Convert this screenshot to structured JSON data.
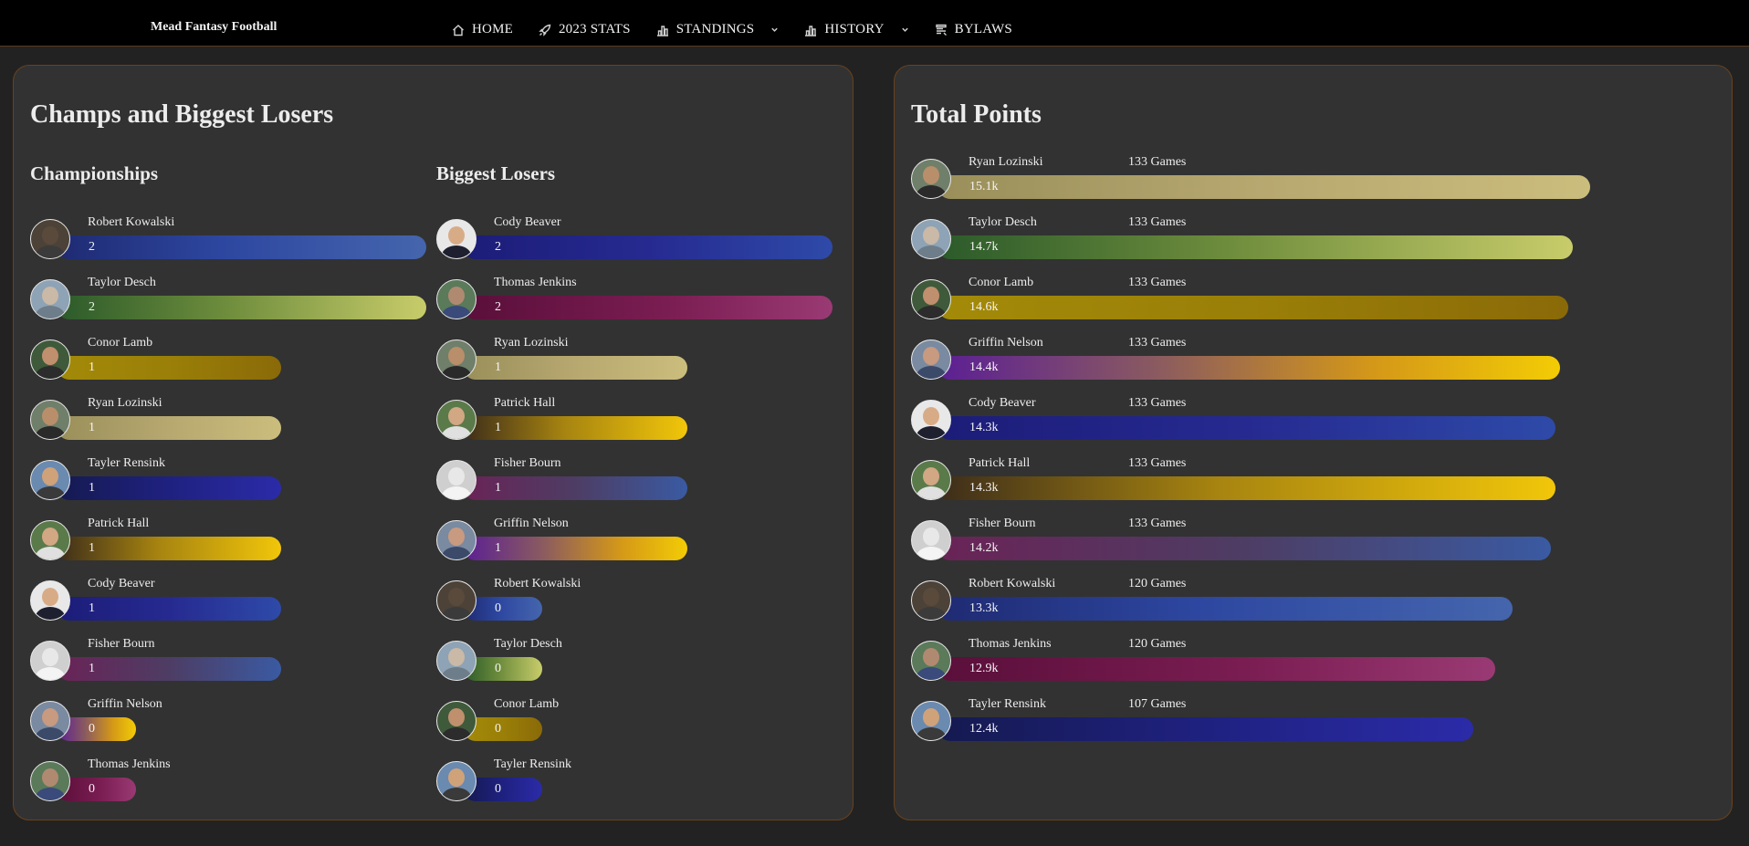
{
  "nav": {
    "brand": "Mead Fantasy Football",
    "items": [
      {
        "label": "HOME",
        "icon": "home-icon"
      },
      {
        "label": "2023 STATS",
        "icon": "rocket-icon"
      },
      {
        "label": "STANDINGS",
        "icon": "bar-chart-icon",
        "dropdown": true
      },
      {
        "label": "HISTORY",
        "icon": "bar-chart-icon",
        "dropdown": true
      },
      {
        "label": "BYLAWS",
        "icon": "document-icon"
      }
    ]
  },
  "champs_card": {
    "title": "Champs and Biggest Losers",
    "championships": {
      "title": "Championships",
      "rows": [
        {
          "name": "Robert Kowalski",
          "value": "2",
          "gradient": "blue",
          "bar_fraction": 1.0
        },
        {
          "name": "Taylor Desch",
          "value": "2",
          "gradient": "green",
          "bar_fraction": 1.0
        },
        {
          "name": "Conor Lamb",
          "value": "1",
          "gradient": "gold",
          "bar_fraction": 0.5
        },
        {
          "name": "Ryan Lozinski",
          "value": "1",
          "gradient": "tan",
          "bar_fraction": 0.5
        },
        {
          "name": "Tayler Rensink",
          "value": "1",
          "gradient": "navy",
          "bar_fraction": 0.5
        },
        {
          "name": "Patrick Hall",
          "value": "1",
          "gradient": "brgold",
          "bar_fraction": 0.5
        },
        {
          "name": "Cody Beaver",
          "value": "1",
          "gradient": "indigo",
          "bar_fraction": 0.5
        },
        {
          "name": "Fisher Bourn",
          "value": "1",
          "gradient": "mauve",
          "bar_fraction": 0.5
        },
        {
          "name": "Griffin Nelson",
          "value": "0",
          "gradient": "purple",
          "bar_fraction": 0
        },
        {
          "name": "Thomas Jenkins",
          "value": "0",
          "gradient": "maroon",
          "bar_fraction": 0
        }
      ]
    },
    "losers": {
      "title": "Biggest Losers",
      "rows": [
        {
          "name": "Cody Beaver",
          "value": "2",
          "gradient": "indigo",
          "bar_fraction": 1.0
        },
        {
          "name": "Thomas Jenkins",
          "value": "2",
          "gradient": "maroon",
          "bar_fraction": 1.0
        },
        {
          "name": "Ryan Lozinski",
          "value": "1",
          "gradient": "tan",
          "bar_fraction": 0.5
        },
        {
          "name": "Patrick Hall",
          "value": "1",
          "gradient": "brgold",
          "bar_fraction": 0.5
        },
        {
          "name": "Fisher Bourn",
          "value": "1",
          "gradient": "mauve",
          "bar_fraction": 0.5
        },
        {
          "name": "Griffin Nelson",
          "value": "1",
          "gradient": "purple",
          "bar_fraction": 0.5
        },
        {
          "name": "Robert Kowalski",
          "value": "0",
          "gradient": "blue",
          "bar_fraction": 0
        },
        {
          "name": "Taylor Desch",
          "value": "0",
          "gradient": "green",
          "bar_fraction": 0
        },
        {
          "name": "Conor Lamb",
          "value": "0",
          "gradient": "gold",
          "bar_fraction": 0
        },
        {
          "name": "Tayler Rensink",
          "value": "0",
          "gradient": "navy",
          "bar_fraction": 0
        }
      ]
    }
  },
  "points_card": {
    "title": "Total Points",
    "rows": [
      {
        "name": "Ryan Lozinski",
        "games": "133 Games",
        "value": "15.1k",
        "gradient": "tan",
        "points": 15.1
      },
      {
        "name": "Taylor Desch",
        "games": "133 Games",
        "value": "14.7k",
        "gradient": "green",
        "points": 14.7
      },
      {
        "name": "Conor Lamb",
        "games": "133 Games",
        "value": "14.6k",
        "gradient": "gold",
        "points": 14.6
      },
      {
        "name": "Griffin Nelson",
        "games": "133 Games",
        "value": "14.4k",
        "gradient": "purple",
        "points": 14.4
      },
      {
        "name": "Cody Beaver",
        "games": "133 Games",
        "value": "14.3k",
        "gradient": "indigo",
        "points": 14.3
      },
      {
        "name": "Patrick Hall",
        "games": "133 Games",
        "value": "14.3k",
        "gradient": "brgold",
        "points": 14.3
      },
      {
        "name": "Fisher Bourn",
        "games": "133 Games",
        "value": "14.2k",
        "gradient": "mauve",
        "points": 14.2
      },
      {
        "name": "Robert Kowalski",
        "games": "120 Games",
        "value": "13.3k",
        "gradient": "blue",
        "points": 13.3
      },
      {
        "name": "Thomas Jenkins",
        "games": "120 Games",
        "value": "12.9k",
        "gradient": "maroon",
        "points": 12.9
      },
      {
        "name": "Tayler Rensink",
        "games": "107 Games",
        "value": "12.4k",
        "gradient": "navy",
        "points": 12.4
      }
    ]
  },
  "avatar_tones": {
    "Robert Kowalski": [
      "#5a4a3c",
      "#3b3b3b",
      "#4d4237"
    ],
    "Taylor Desch": [
      "#c9b9a6",
      "#6d7d8a",
      "#8ea3b5"
    ],
    "Conor Lamb": [
      "#c08f6e",
      "#2c2c2c",
      "#3f5a3a"
    ],
    "Ryan Lozinski": [
      "#b88f6a",
      "#2a2a2a",
      "#6f7f6a"
    ],
    "Tayler Rensink": [
      "#d0a27a",
      "#3a3a3a",
      "#6a8ab0"
    ],
    "Patrick Hall": [
      "#d1a784",
      "#e0e0e0",
      "#5a7a4a"
    ],
    "Cody Beaver": [
      "#d8ab87",
      "#1e2030",
      "#e8e8e8"
    ],
    "Fisher Bourn": [
      "#e8e8e8",
      "#f4f4f4",
      "#cfcfcf"
    ],
    "Griffin Nelson": [
      "#c89a80",
      "#3c4a6a",
      "#7a8aa0"
    ],
    "Thomas Jenkins": [
      "#b08a70",
      "#3a4a7a",
      "#5a7a5a"
    ]
  }
}
